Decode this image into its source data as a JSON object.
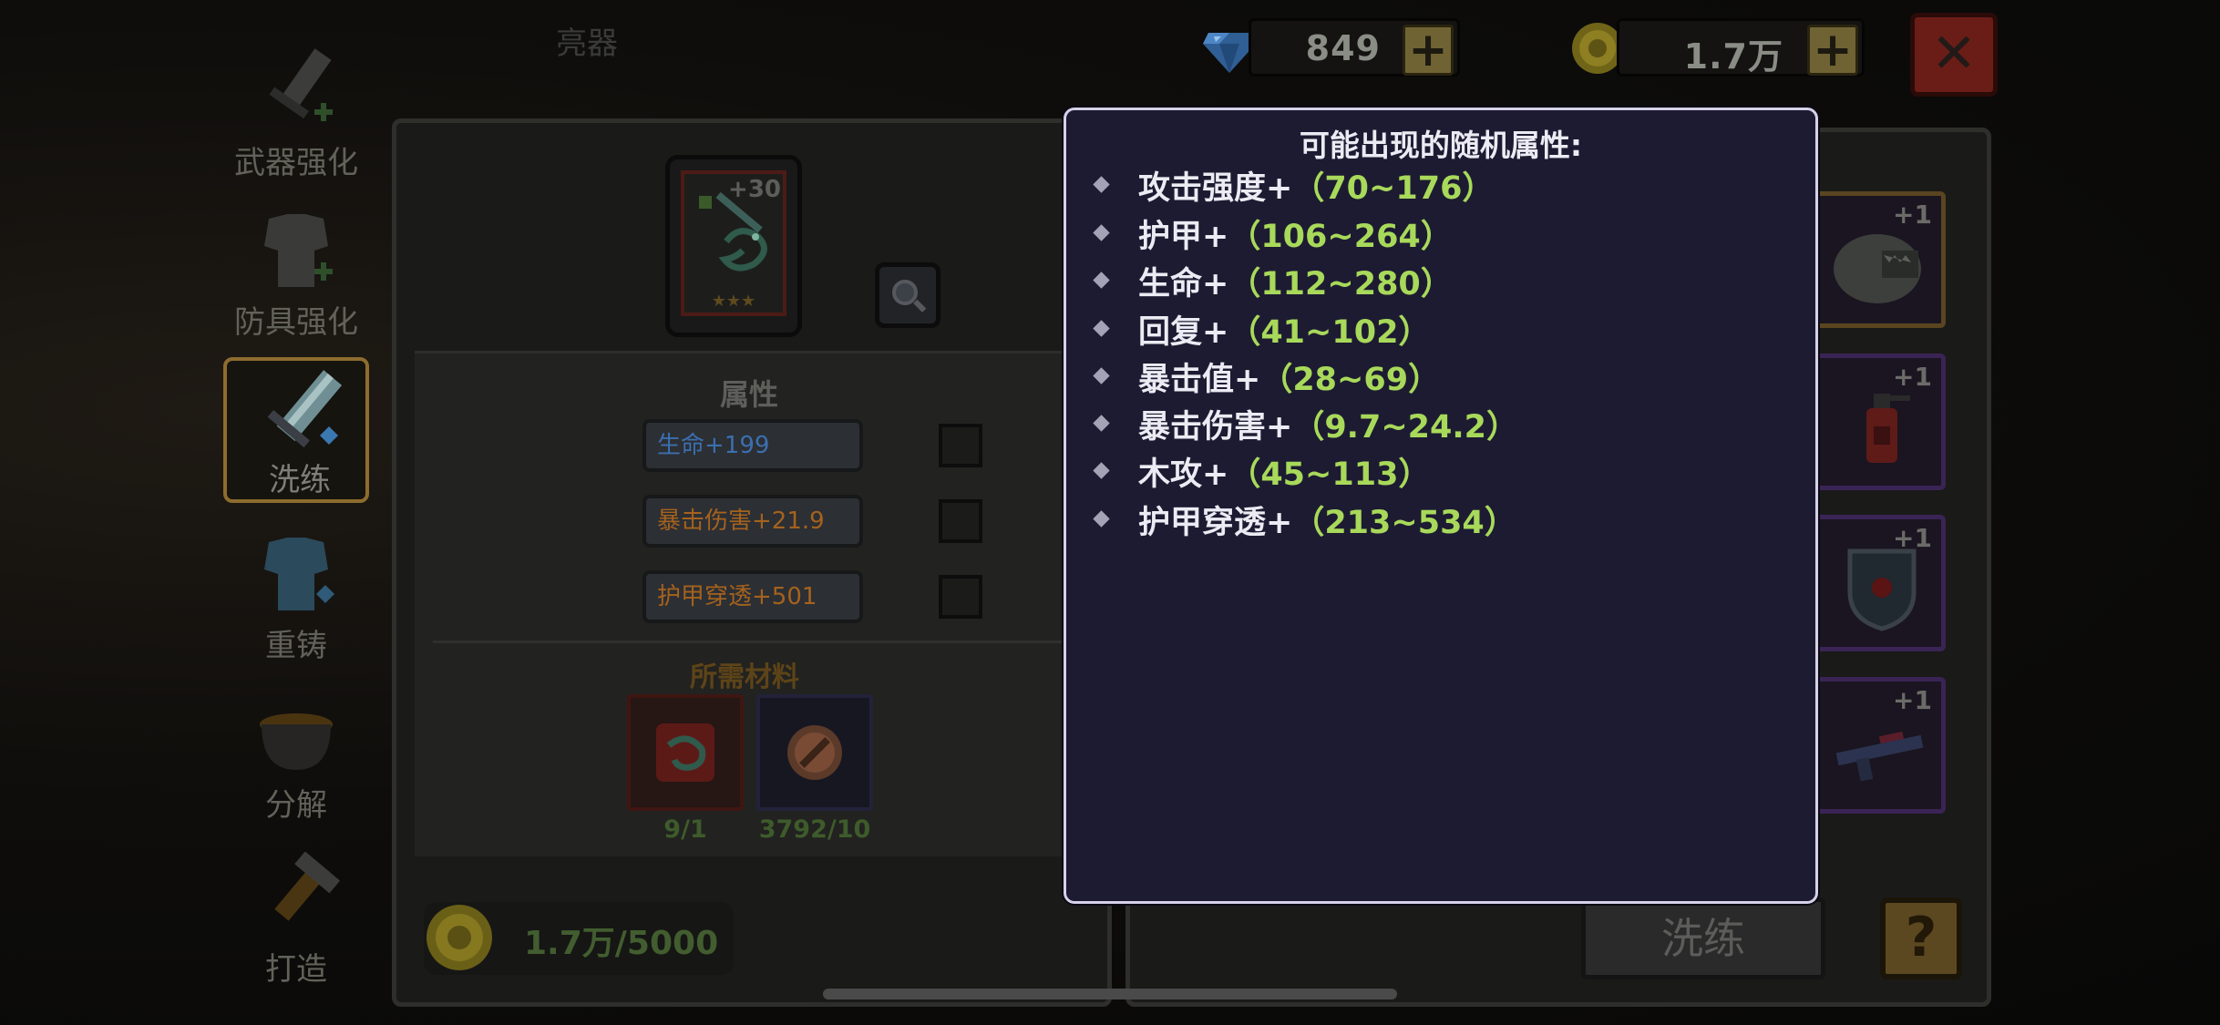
{
  "topbar": {
    "gem_count": "849",
    "gold_count": "1.7万",
    "plus_symbol": "+",
    "close_symbol": "✕",
    "faded_label": "亮器"
  },
  "sidebar": {
    "items": [
      {
        "label": "武器强化",
        "icon": "sword-upgrade-icon"
      },
      {
        "label": "防具强化",
        "icon": "armor-upgrade-icon"
      },
      {
        "label": "洗练",
        "icon": "reroll-sword-icon"
      },
      {
        "label": "重铸",
        "icon": "recast-armor-icon"
      },
      {
        "label": "分解",
        "icon": "cauldron-icon"
      },
      {
        "label": "打造",
        "icon": "forge-hammer-icon"
      }
    ]
  },
  "equipment": {
    "level_badge": "+30",
    "stars": "★★★",
    "attributes_header": "属性",
    "attributes": [
      {
        "label": "生命+199",
        "color": "#3b6fb0"
      },
      {
        "label": "暴击伤害+21.9",
        "color": "#a4621e"
      },
      {
        "label": "护甲穿透+501",
        "color": "#a4621e"
      }
    ],
    "materials_header": "所需材料",
    "materials": [
      {
        "count": "9/1",
        "icon": "weapon-material-icon"
      },
      {
        "count": "3792/10",
        "icon": "reroll-stone-icon"
      }
    ],
    "gold_cost": "1.7万/5000"
  },
  "right_panel": {
    "slots": [
      {
        "plus": "+1",
        "icon": "dragon-pet-icon"
      },
      {
        "plus": "+1",
        "icon": "fire-extinguisher-icon"
      },
      {
        "plus": "+1",
        "icon": "shield-icon"
      },
      {
        "plus": "+1",
        "icon": "gun-icon"
      }
    ],
    "wash_button": "洗练",
    "help_button": "?"
  },
  "tooltip": {
    "title": "可能出现的随机属性:",
    "rows": [
      {
        "name": "攻击强度+",
        "range": "（70~176）"
      },
      {
        "name": "护甲+",
        "range": "（106~264）"
      },
      {
        "name": "生命+",
        "range": "（112~280）"
      },
      {
        "name": "回复+",
        "range": "（41~102）"
      },
      {
        "name": "暴击值+",
        "range": "（28~69）"
      },
      {
        "name": "暴击伤害+",
        "range": "（9.7~24.2）"
      },
      {
        "name": "木攻+",
        "range": "（45~113）"
      },
      {
        "name": "护甲穿透+",
        "range": "（213~534）"
      }
    ]
  },
  "colors": {
    "tooltip_bg": "#1d1b32",
    "range_green": "#a8d95a",
    "selected_frame": "#c89a3c"
  }
}
